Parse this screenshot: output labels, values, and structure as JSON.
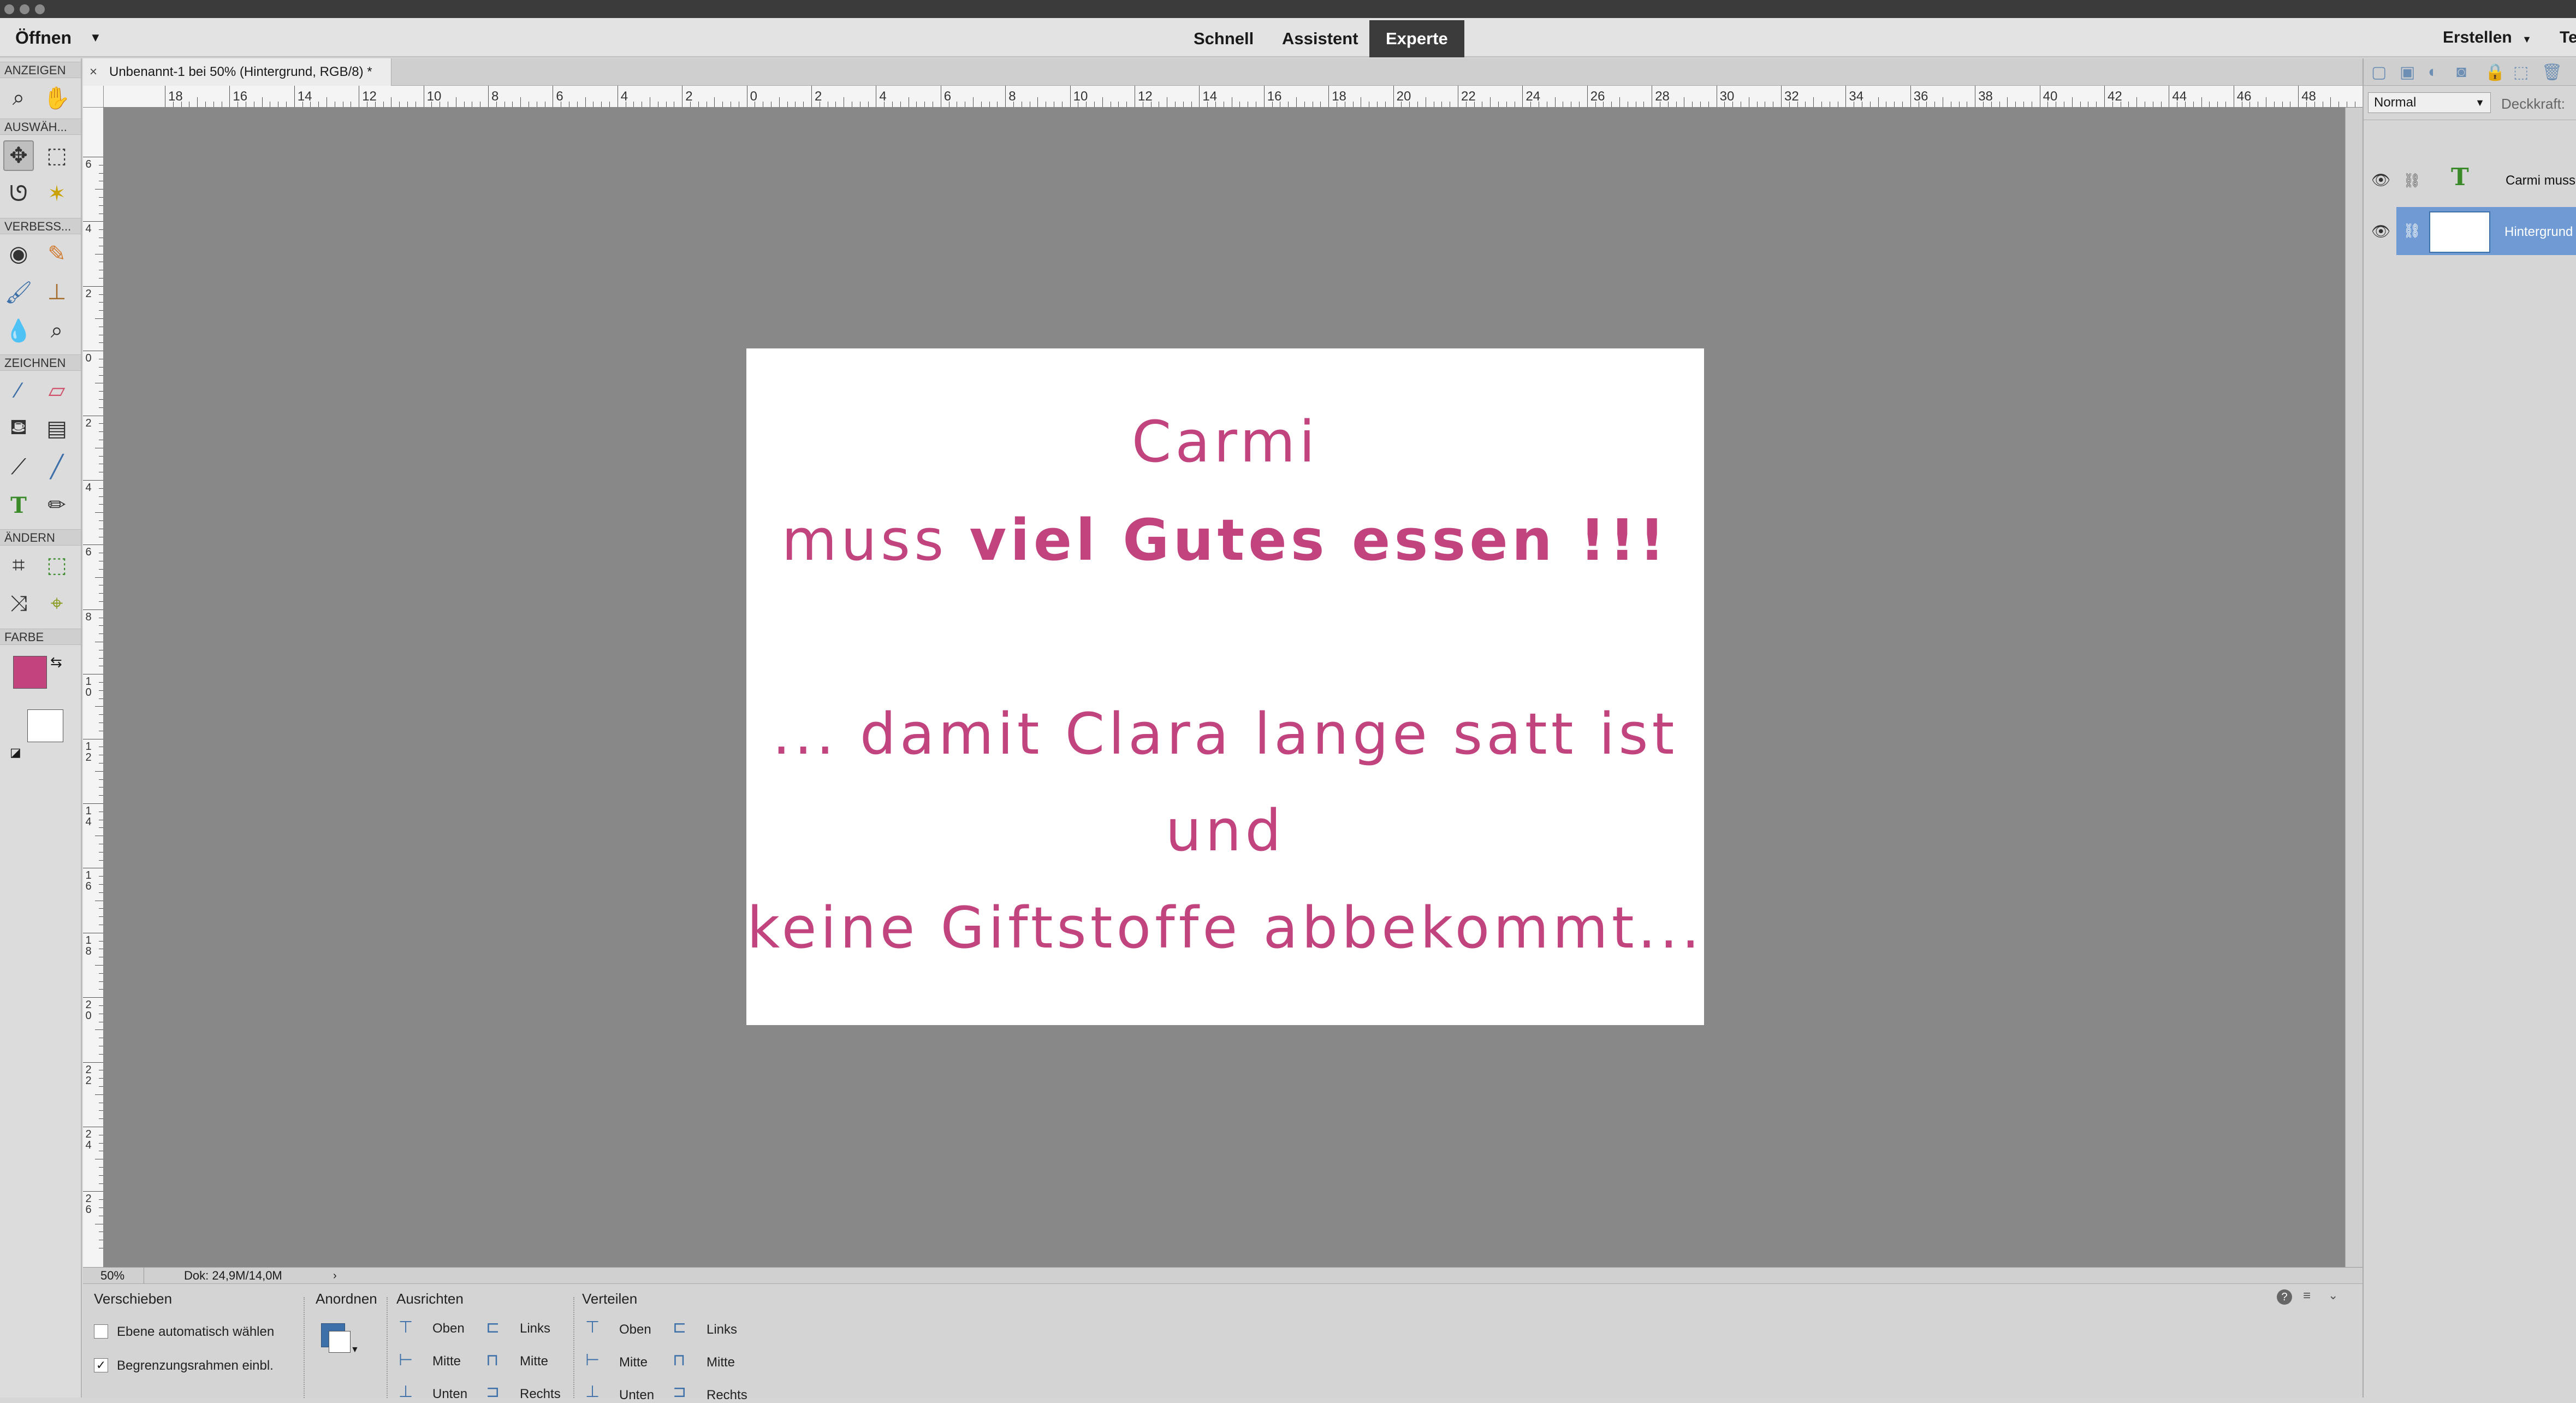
{
  "menubar": {
    "open_label": "Öffnen",
    "modes": [
      "Schnell",
      "Assistent",
      "Experte"
    ],
    "active_mode": "Experte",
    "create_label": "Erstellen",
    "cut_label": "Te"
  },
  "toolbox": {
    "sections": {
      "view": "ANZEIGEN",
      "select": "AUSWÄH...",
      "enhance": "VERBESS...",
      "draw": "ZEICHNEN",
      "modify": "ÄNDERN",
      "color": "FARBE"
    },
    "foreground_color": "#c2447e",
    "background_color": "#ffffff"
  },
  "document_tab": {
    "title": "Unbenannt-1 bei 50% (Hintergrund, RGB/8) *",
    "close_glyph": "×"
  },
  "ruler": {
    "h_labels": [
      "18",
      "16",
      "14",
      "12",
      "10",
      "8",
      "6",
      "4",
      "2",
      "0",
      "2",
      "4",
      "6",
      "8",
      "10",
      "12",
      "14",
      "16",
      "18",
      "20",
      "22",
      "24",
      "26",
      "28",
      "30",
      "32",
      "34",
      "36",
      "38",
      "40",
      "42",
      "44",
      "46",
      "48"
    ],
    "v_labels": [
      "6",
      "4",
      "2",
      "0",
      "2",
      "4",
      "6",
      "8",
      "10",
      "12",
      "14",
      "16",
      "18",
      "20",
      "22",
      "24",
      "26"
    ]
  },
  "canvas_text": {
    "line1": "Carmi",
    "line2a": "muss ",
    "line2b": "viel Gutes essen !!!",
    "line3": "... damit Clara lange satt ist",
    "line4": "und",
    "line5": "keine Giftstoffe abbekommt...",
    "text_color": "#c2447e"
  },
  "status": {
    "zoom": "50%",
    "doc_size": "Dok: 24,9M/14,0M"
  },
  "options": {
    "move_title": "Verschieben",
    "auto_select": "Ebene automatisch wählen",
    "show_bounds": "Begrenzungsrahmen einbl.",
    "arrange_title": "Anordnen",
    "align_title": "Ausrichten",
    "distribute_title": "Verteilen",
    "top": "Oben",
    "middle": "Mitte",
    "bottom": "Unten",
    "left": "Links",
    "center": "Mitte",
    "right": "Rechts"
  },
  "layers_panel": {
    "blend_mode": "Normal",
    "opacity_label": "Deckkraft:",
    "layers": [
      {
        "name": "Carmi muss",
        "type": "text"
      },
      {
        "name": "Hintergrund",
        "type": "image",
        "selected": true
      }
    ]
  }
}
